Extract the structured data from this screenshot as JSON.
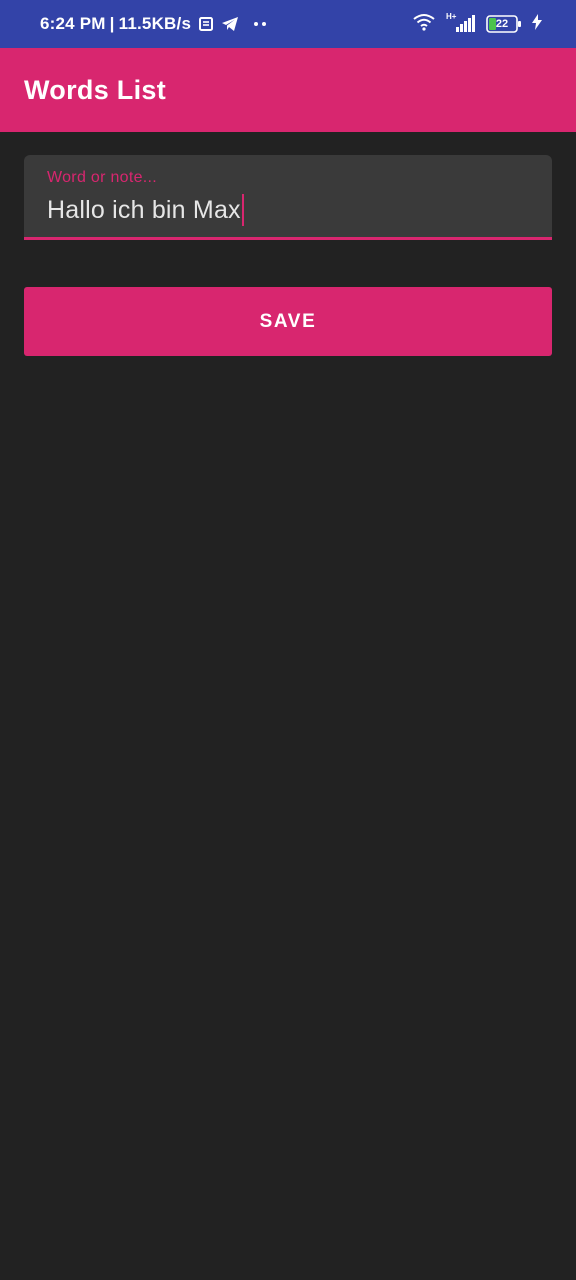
{
  "status_bar": {
    "time": "6:24 PM",
    "separator": "|",
    "network_speed": "11.5KB/s",
    "notification_icons": [
      "message-icon",
      "telegram-icon",
      "more-dots-icon"
    ],
    "signal_label": "H+",
    "battery_level": "22",
    "icons": [
      "wifi-icon",
      "signal-icon",
      "battery-icon",
      "charging-icon"
    ]
  },
  "app_bar": {
    "title": "Words List",
    "color": "#d8266f"
  },
  "form": {
    "word_input": {
      "label": "Word or note...",
      "value": "Hallo ich bin Max"
    },
    "save_label": "SAVE"
  },
  "colors": {
    "status_bar": "#3343a8",
    "accent": "#d8266f",
    "background": "#222222",
    "field_background": "#3a3a3a"
  }
}
